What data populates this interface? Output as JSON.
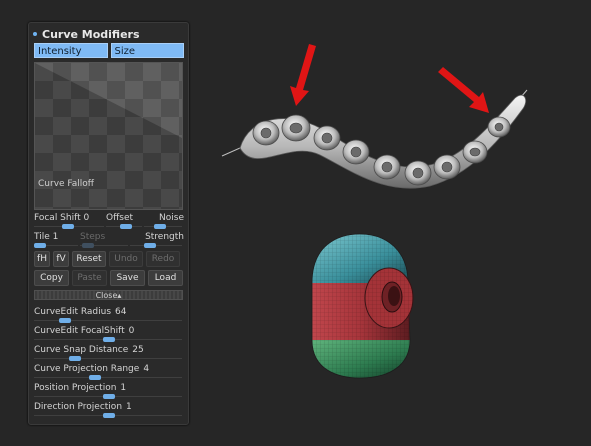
{
  "panel": {
    "title": "Curve Modifiers",
    "tabs": [
      "Intensity",
      "Size"
    ],
    "curve_label": "Curve Falloff"
  },
  "params": {
    "focal_shift_label": "Focal Shift",
    "focal_shift_value": "0",
    "offset_label": "Offset",
    "noise_label": "Noise",
    "tile_label": "Tile",
    "tile_value": "1",
    "steps_label": "Steps",
    "strength_label": "Strength"
  },
  "buttons": {
    "fh": "fH",
    "fv": "fV",
    "reset": "Reset",
    "undo": "Undo",
    "redo": "Redo",
    "copy": "Copy",
    "paste": "Paste",
    "save": "Save",
    "load": "Load",
    "close": "Close"
  },
  "curve_edit": [
    {
      "label": "CurveEdit Radius",
      "value": "64",
      "level": 0.18
    },
    {
      "label": "CurveEdit FocalShift",
      "value": "0",
      "level": 0.5
    },
    {
      "label": "Curve Snap Distance",
      "value": "25",
      "level": 0.25
    },
    {
      "label": "Curve Projection Range",
      "value": "4",
      "level": 0.4
    },
    {
      "label": "Position Projection",
      "value": "1",
      "level": 0.5
    },
    {
      "label": "Direction Projection",
      "value": "1",
      "level": 0.5
    }
  ],
  "colors": {
    "accent": "#7fbaf5",
    "arrow": "#e01515",
    "background": "#262626"
  }
}
